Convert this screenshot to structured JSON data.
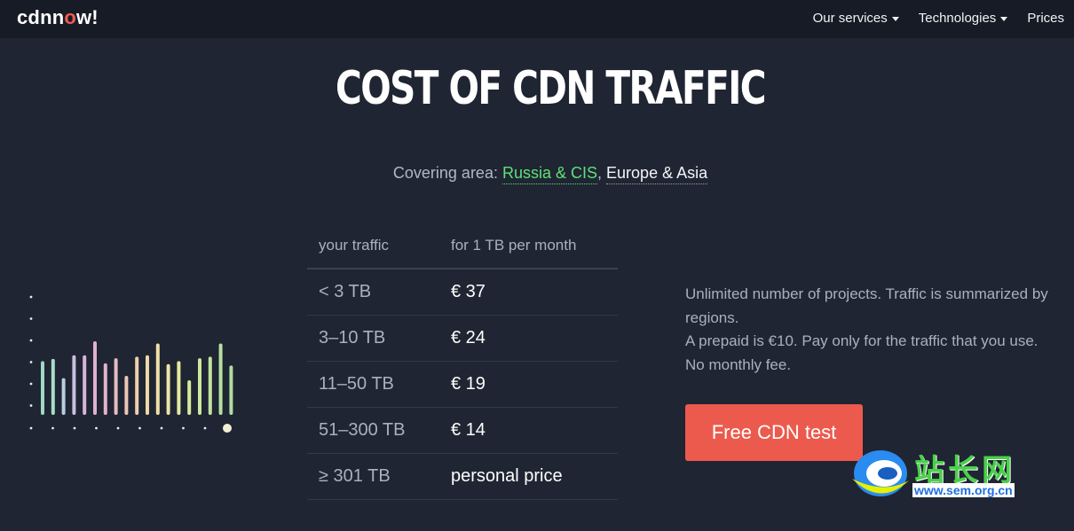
{
  "header": {
    "logo": {
      "part1": "cdnn",
      "part2": "o",
      "part3": "w!"
    },
    "nav": [
      {
        "label": "Our services",
        "has_caret": true
      },
      {
        "label": "Technologies",
        "has_caret": true
      },
      {
        "label": "Prices",
        "has_caret": false
      }
    ]
  },
  "main": {
    "title": "COST OF CDN TRAFFIC",
    "covering": {
      "prefix": "Covering area: ",
      "regions": [
        "Russia & CIS",
        "Europe & Asia"
      ],
      "separator": ", "
    },
    "table": {
      "headers": [
        "your traffic",
        "for 1 TB per month"
      ],
      "rows": [
        {
          "traffic": "< 3 TB",
          "price": "€ 37"
        },
        {
          "traffic": "3–10 TB",
          "price": "€ 24"
        },
        {
          "traffic": "11–50 TB",
          "price": "€ 19"
        },
        {
          "traffic": "51–300 TB",
          "price": "€ 14"
        },
        {
          "traffic": "≥ 301 TB",
          "price": "personal price"
        }
      ]
    },
    "description": {
      "line1": "Unlimited number of projects. Traffic is summarized by regions.",
      "line2": "A prepaid is €10. Pay only for the traffic that you use. No monthly fee."
    },
    "cta_label": "Free CDN test"
  },
  "decor_bars": {
    "values": [
      0.73,
      0.76,
      0.5,
      0.81,
      0.81,
      1.0,
      0.7,
      0.77,
      0.53,
      0.79,
      0.81,
      0.97,
      0.69,
      0.73,
      0.47,
      0.77,
      0.79,
      0.97,
      0.67
    ],
    "colors": [
      "#9fd8c4",
      "#a8ddc8",
      "#b8cfe0",
      "#c9bfe0",
      "#d6b6d9",
      "#e0b0cf",
      "#e3b3c8",
      "#e6bcc0",
      "#ecc6b6",
      "#eed0ad",
      "#efd8a8",
      "#efdfa7",
      "#ece6a8",
      "#e6ea9f",
      "#d7ea9c",
      "#cce7a0",
      "#c2e39f",
      "#b8e0a0",
      "#b1dda0"
    ]
  },
  "watermark": {
    "text": "站长网",
    "url": "www.sem.org.cn"
  }
}
